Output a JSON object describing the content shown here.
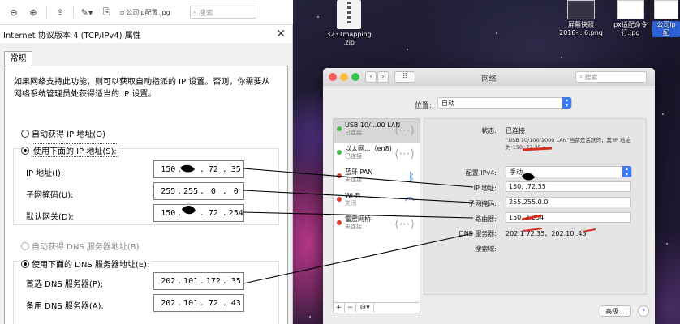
{
  "viewer": {
    "filename": "公司ip配置.jpg",
    "search_placeholder": "搜索"
  },
  "dialog": {
    "title": "Internet 协议版本 4 (TCP/IPv4) 属性",
    "tab": "常规",
    "description": "如果网络支持此功能，则可以获取自动指派的 IP 设置。否则，你需要从网络系统管理员处获得适当的 IP 设置。",
    "radio_auto_ip": "自动获得 IP 地址(O)",
    "radio_manual_ip": "使用下面的 IP 地址(S):",
    "ip_label": "IP 地址(I):",
    "mask_label": "子网掩码(U):",
    "gateway_label": "默认网关(D):",
    "ip_value": [
      "150",
      "",
      "72",
      "35"
    ],
    "mask_value": [
      "255",
      "255",
      "0",
      "0"
    ],
    "gateway_value": [
      "150",
      "",
      "72",
      "254"
    ],
    "radio_auto_dns": "自动获得 DNS 服务器地址(B)",
    "radio_manual_dns": "使用下面的 DNS 服务器地址(E):",
    "dns1_label": "首选 DNS 服务器(P):",
    "dns2_label": "备用 DNS 服务器(A):",
    "dns1_value": [
      "202",
      "101",
      "172",
      "35"
    ],
    "dns2_value": [
      "202",
      "101",
      "72",
      "43"
    ]
  },
  "desktop": {
    "zip_name": "3231mapping",
    "zip_ext": ".zip",
    "screenshot_name": "屏幕快照",
    "screenshot_sub": "2018-...6.png",
    "cmd_name": "px适配命令",
    "cmd_sub": "行.jpg",
    "company_name": "公司ip配"
  },
  "mac": {
    "title": "网络",
    "search_placeholder": "搜索",
    "location_label": "位置:",
    "location_value": "自动",
    "services": [
      {
        "name": "USB 10/...00 LAN",
        "status": "已连接",
        "led": "#3fbf3f"
      },
      {
        "name": "以太网...（en8)",
        "status": "已连接",
        "led": "#3fbf3f"
      },
      {
        "name": "蓝牙 PAN",
        "status": "未连接",
        "led": "#e0392b"
      },
      {
        "name": "Wi-Fi",
        "status": "关闭",
        "led": "#e0392b"
      },
      {
        "name": "雷雳网桥",
        "status": "未连接",
        "led": "#e0392b"
      }
    ],
    "status_label": "状态:",
    "status_value": "已连接",
    "status_desc_1": "“USB 10/100/1000 LAN”当前是活跃的，其 IP 地址",
    "status_desc_2": "为 150.     72.35。",
    "configure_label": "配置 IPv4:",
    "configure_value": "手动",
    "ip_label": "IP 地址:",
    "ip_value": "150.      .72.35",
    "mask_label": "子网掩码:",
    "mask_value": "255.255.0.0",
    "router_label": "路由器:",
    "router_value": "150.        2.254",
    "dns_label": "DNS 服务器:",
    "dns_value": "202.1      72.35、202.10      .43",
    "search_domain_label": "搜索域:",
    "advanced": "高级...",
    "help": "?"
  }
}
